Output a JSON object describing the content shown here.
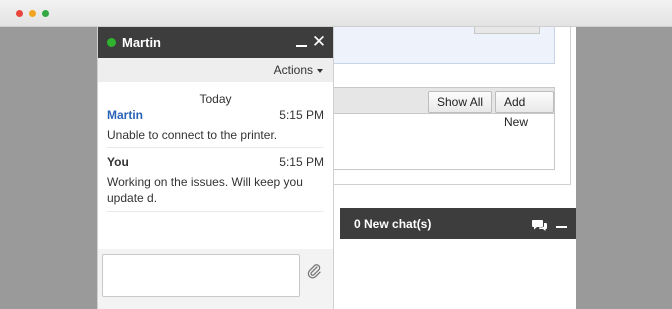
{
  "chat_window": {
    "contact_name": "Martin",
    "actions_label": "Actions",
    "day_label": "Today",
    "messages": [
      {
        "sender": "Martin",
        "time": "5:15 PM",
        "text": "Unable to connect to the printer."
      },
      {
        "sender": "You",
        "time": "5:15 PM",
        "text": "Working on the issues. Will keep you update d."
      }
    ],
    "message_placeholder": ""
  },
  "background_panel": {
    "top_button_label": "Show All",
    "show_all_label": "Show All",
    "add_new_label": "Add New"
  },
  "new_chats_panel": {
    "title": "0 New chat(s)"
  },
  "colors": {
    "header_dark": "#3d3d3d",
    "online_green": "#2fb32f",
    "sender_blue": "#2a64b8",
    "close_red": "#e9453b",
    "minimize_yellow": "#f3a421",
    "zoom_green": "#32a844"
  }
}
